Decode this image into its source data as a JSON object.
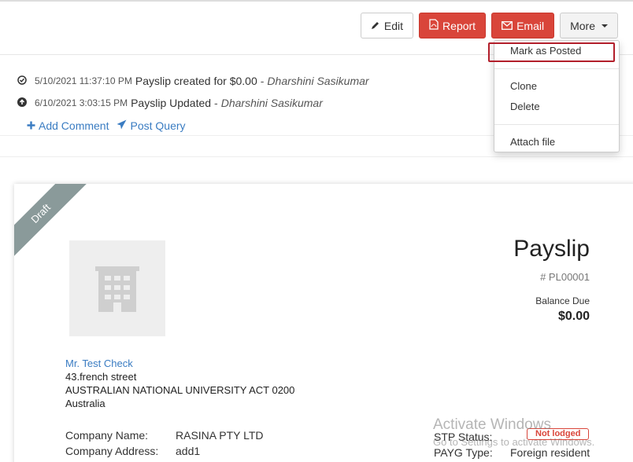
{
  "toolbar": {
    "edit_label": "Edit",
    "report_label": "Report",
    "email_label": "Email",
    "more_label": "More",
    "accent_red": "#d9453a"
  },
  "more_menu": {
    "items": [
      "Mark as Posted",
      "Clone",
      "Delete",
      "Attach file"
    ]
  },
  "activity": [
    {
      "icon": "check-circle-icon",
      "time": "5/10/2021 11:37:10 PM",
      "text": "Payslip created for $0.00",
      "user": "Dharshini Sasikumar"
    },
    {
      "icon": "arrow-up-circle-icon",
      "time": "6/10/2021 3:03:15 PM",
      "text": "Payslip Updated",
      "user": "Dharshini Sasikumar"
    }
  ],
  "links": {
    "add_comment": "Add Comment",
    "post_query": "Post Query"
  },
  "document": {
    "ribbon": "Draft",
    "title": "Payslip",
    "number": "# PL00001",
    "balance_label": "Balance Due",
    "balance_value": "$0.00",
    "address": {
      "name": "Mr. Test Check",
      "line1": "43.french street",
      "line2": "AUSTRALIAN NATIONAL UNIVERSITY ACT 0200",
      "line3": "Australia"
    },
    "company_name_label": "Company Name:",
    "company_name_value": "RASINA PTY LTD",
    "company_address_label": "Company Address:",
    "company_address_value": "add1",
    "stp_status_label": "STP Status:",
    "stp_status_value": "Not lodged",
    "payg_type_label": "PAYG Type:",
    "payg_type_value": "Foreign resident"
  },
  "watermark": {
    "title": "Activate Windows",
    "subtitle": "Go to Settings to activate Windows."
  }
}
